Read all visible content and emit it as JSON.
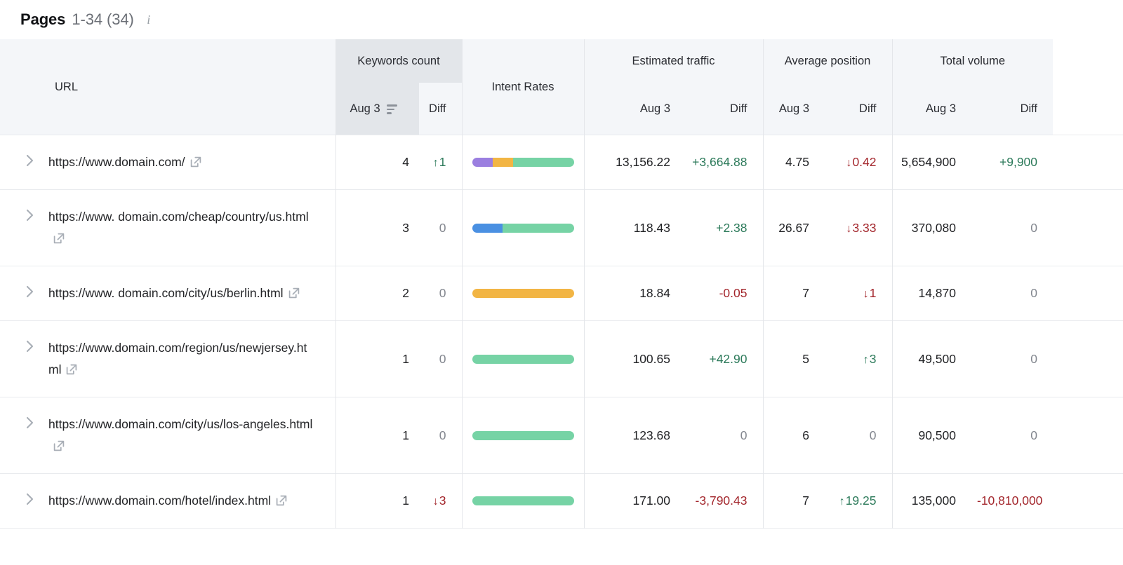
{
  "header": {
    "title": "Pages",
    "range": "1-34 (34)",
    "info_icon": "info-icon"
  },
  "table": {
    "columns": {
      "url": "URL",
      "keywords_count": "Keywords count",
      "intent_rates": "Intent Rates",
      "estimated_traffic": "Estimated traffic",
      "average_position": "Average position",
      "total_volume": "Total volume"
    },
    "subcolumns": {
      "date": "Aug 3",
      "diff": "Diff"
    },
    "sort": {
      "column": "keywords_count",
      "subcolumn": "Aug 3",
      "icon": "sort-descending-icon"
    },
    "intent_colors": {
      "informational": "#4a90e2",
      "navigational": "#9b7fe0",
      "commercial": "#f2b544",
      "transactional": "#76d3a5"
    },
    "rows": [
      {
        "expand_icon": "chevron-right-icon",
        "url": "https://www.domain.com/",
        "external_icon": "external-link-icon",
        "keywords_count": "4",
        "keywords_diff": "1",
        "keywords_diff_dir": "up",
        "intent": [
          {
            "color": "#9b7fe0",
            "pct": 20
          },
          {
            "color": "#f2b544",
            "pct": 20
          },
          {
            "color": "#76d3a5",
            "pct": 60
          }
        ],
        "traffic": "13,156.22",
        "traffic_diff": "+3,664.88",
        "traffic_diff_dir": "up",
        "position": "4.75",
        "position_diff": "0.42",
        "position_diff_dir": "down",
        "volume": "5,654,900",
        "volume_diff": "+9,900",
        "volume_diff_dir": "up"
      },
      {
        "expand_icon": "chevron-right-icon",
        "url": "https://www. domain.com/cheap/country/us.html",
        "external_icon": "external-link-icon",
        "keywords_count": "3",
        "keywords_diff": "0",
        "keywords_diff_dir": "zero",
        "intent": [
          {
            "color": "#4a90e2",
            "pct": 30
          },
          {
            "color": "#76d3a5",
            "pct": 70
          }
        ],
        "traffic": "118.43",
        "traffic_diff": "+2.38",
        "traffic_diff_dir": "up",
        "position": "26.67",
        "position_diff": "3.33",
        "position_diff_dir": "down",
        "volume": "370,080",
        "volume_diff": "0",
        "volume_diff_dir": "zero"
      },
      {
        "expand_icon": "chevron-right-icon",
        "url": "https://www. domain.com/city/us/berlin.html",
        "external_icon": "external-link-icon",
        "keywords_count": "2",
        "keywords_diff": "0",
        "keywords_diff_dir": "zero",
        "intent": [
          {
            "color": "#f2b544",
            "pct": 100
          }
        ],
        "traffic": "18.84",
        "traffic_diff": "-0.05",
        "traffic_diff_dir": "down",
        "position": "7",
        "position_diff": "1",
        "position_diff_dir": "down",
        "volume": "14,870",
        "volume_diff": "0",
        "volume_diff_dir": "zero"
      },
      {
        "expand_icon": "chevron-right-icon",
        "url": "https://www.domain.com/region/us/newjersey.html",
        "external_icon": "external-link-icon",
        "keywords_count": "1",
        "keywords_diff": "0",
        "keywords_diff_dir": "zero",
        "intent": [
          {
            "color": "#76d3a5",
            "pct": 100
          }
        ],
        "traffic": "100.65",
        "traffic_diff": "+42.90",
        "traffic_diff_dir": "up",
        "position": "5",
        "position_diff": "3",
        "position_diff_dir": "up",
        "volume": "49,500",
        "volume_diff": "0",
        "volume_diff_dir": "zero"
      },
      {
        "expand_icon": "chevron-right-icon",
        "url": "https://www.domain.com/city/us/los-angeles.html",
        "external_icon": "external-link-icon",
        "keywords_count": "1",
        "keywords_diff": "0",
        "keywords_diff_dir": "zero",
        "intent": [
          {
            "color": "#76d3a5",
            "pct": 100
          }
        ],
        "traffic": "123.68",
        "traffic_diff": "0",
        "traffic_diff_dir": "zero",
        "position": "6",
        "position_diff": "0",
        "position_diff_dir": "zero",
        "volume": "90,500",
        "volume_diff": "0",
        "volume_diff_dir": "zero"
      },
      {
        "expand_icon": "chevron-right-icon",
        "url": "https://www.domain.com/hotel/index.html",
        "external_icon": "external-link-icon",
        "keywords_count": "1",
        "keywords_diff": "3",
        "keywords_diff_dir": "down",
        "intent": [
          {
            "color": "#76d3a5",
            "pct": 100
          }
        ],
        "traffic": "171.00",
        "traffic_diff": "-3,790.43",
        "traffic_diff_dir": "down",
        "position": "7",
        "position_diff": "19.25",
        "position_diff_dir": "up",
        "volume": "135,000",
        "volume_diff": "-10,810,000",
        "volume_diff_dir": "down"
      }
    ]
  }
}
